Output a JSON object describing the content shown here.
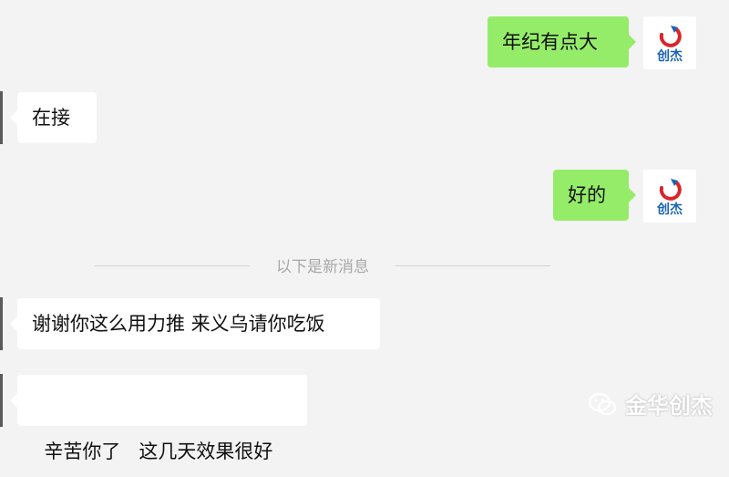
{
  "messages": [
    {
      "id": "m1",
      "side": "right",
      "text": "年纪有点大"
    },
    {
      "id": "m2",
      "side": "left",
      "text": "在接"
    },
    {
      "id": "m3",
      "side": "right",
      "text": "好的"
    },
    {
      "id": "m4",
      "side": "left",
      "text": "谢谢你这么用力推 来义乌请你吃饭"
    },
    {
      "id": "m5",
      "side": "left",
      "text": "辛苦你了   这几天效果很好"
    }
  ],
  "divider": {
    "text": "以下是新消息"
  },
  "avatar": {
    "logo_text": "创杰",
    "icon": "chuangjie-logo"
  },
  "watermark": {
    "text": "金华创杰",
    "icon": "wechat-icon"
  },
  "colors": {
    "background": "#f3f3f3",
    "bubble_self": "#95ec69",
    "bubble_other": "#ffffff",
    "divider_text": "#a8a8a8",
    "logo_red": "#d9252a",
    "logo_blue": "#1b63b5"
  }
}
